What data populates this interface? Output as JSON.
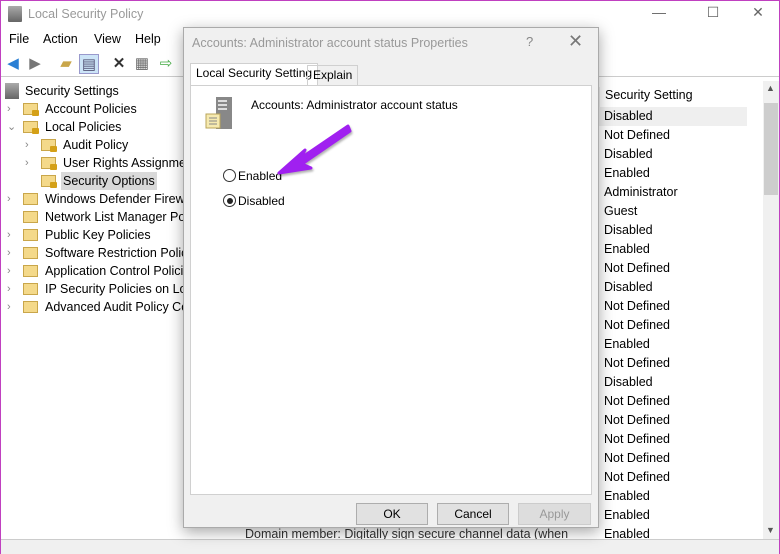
{
  "window": {
    "title": "Local Security Policy",
    "minimize": "—",
    "maximize": "☐",
    "close": "✕"
  },
  "menu": [
    "File",
    "Action",
    "View",
    "Help"
  ],
  "tree": {
    "root": "Security Settings",
    "items": [
      {
        "label": "Account Policies",
        "level": 1,
        "expander": "›",
        "lock": true
      },
      {
        "label": "Local Policies",
        "level": 1,
        "expander": "⌄",
        "lock": true
      },
      {
        "label": "Audit Policy",
        "level": 2,
        "expander": "›",
        "lock": true
      },
      {
        "label": "User Rights Assignment",
        "level": 2,
        "expander": "›",
        "lock": true
      },
      {
        "label": "Security Options",
        "level": 2,
        "expander": "",
        "lock": true,
        "selected": true
      },
      {
        "label": "Windows Defender Firewall with Advanced Security",
        "level": 1,
        "expander": "›",
        "lock": false
      },
      {
        "label": "Network List Manager Policies",
        "level": 1,
        "expander": "",
        "lock": false
      },
      {
        "label": "Public Key Policies",
        "level": 1,
        "expander": "›",
        "lock": false
      },
      {
        "label": "Software Restriction Policies",
        "level": 1,
        "expander": "›",
        "lock": false
      },
      {
        "label": "Application Control Policies",
        "level": 1,
        "expander": "›",
        "lock": false
      },
      {
        "label": "IP Security Policies on Local Computer",
        "level": 1,
        "expander": "›",
        "lock": false
      },
      {
        "label": "Advanced Audit Policy Configuration",
        "level": 1,
        "expander": "›",
        "lock": false
      }
    ]
  },
  "list": {
    "header": "Security Setting",
    "values": [
      "Disabled",
      "Not Defined",
      "Disabled",
      "Enabled",
      "Administrator",
      "Guest",
      "Disabled",
      "Enabled",
      "Not Defined",
      "Disabled",
      "Not Defined",
      "Not Defined",
      "Enabled",
      "Not Defined",
      "Disabled",
      "Not Defined",
      "Not Defined",
      "Not Defined",
      "Not Defined",
      "Not Defined",
      "Enabled",
      "Enabled",
      "Enabled"
    ],
    "partial_policy": "Domain member: Digitally sign secure channel data (when"
  },
  "dialog": {
    "title": "Accounts: Administrator account status Properties",
    "help": "?",
    "close": "✕",
    "tabs": [
      "Local Security Setting",
      "Explain"
    ],
    "policy_name": "Accounts: Administrator account status",
    "options": [
      {
        "label": "Enabled",
        "checked": false
      },
      {
        "label": "Disabled",
        "checked": true
      }
    ],
    "buttons": {
      "ok": "OK",
      "cancel": "Cancel",
      "apply": "Apply"
    }
  },
  "annotation": {
    "arrow_color": "#a020f0"
  }
}
